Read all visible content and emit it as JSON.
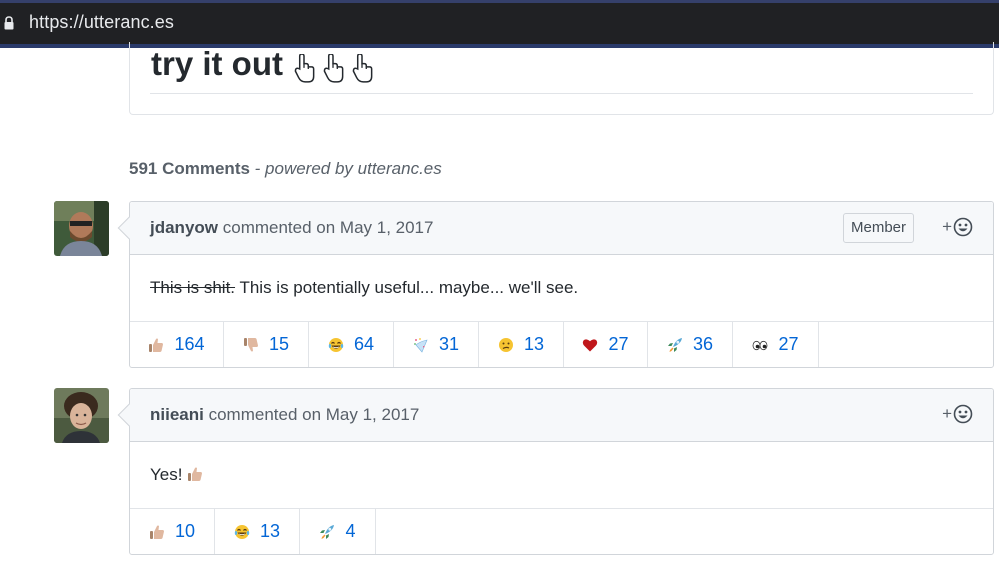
{
  "browser": {
    "url": "https://utteranc.es"
  },
  "hero": {
    "title": "try it out"
  },
  "comments_header": {
    "count_label": "591 Comments",
    "powered_by": " - powered by utteranc.es"
  },
  "comments": [
    {
      "author": "jdanyow",
      "commented_on": " commented on May 1, 2017",
      "badge": "Member",
      "body_struck": "This is shit.",
      "body_text": " This is potentially useful... maybe... we'll see.",
      "reactions": [
        {
          "emoji": "thumbs-up",
          "count": "164"
        },
        {
          "emoji": "thumbs-down",
          "count": "15"
        },
        {
          "emoji": "laugh",
          "count": "64"
        },
        {
          "emoji": "hooray",
          "count": "31"
        },
        {
          "emoji": "confused",
          "count": "13"
        },
        {
          "emoji": "heart",
          "count": "27"
        },
        {
          "emoji": "rocket",
          "count": "36"
        },
        {
          "emoji": "eyes",
          "count": "27"
        }
      ]
    },
    {
      "author": "niieani",
      "commented_on": " commented on May 1, 2017",
      "body_text": "Yes! ",
      "reactions": [
        {
          "emoji": "thumbs-up",
          "count": "10"
        },
        {
          "emoji": "laugh",
          "count": "13"
        },
        {
          "emoji": "rocket",
          "count": "4"
        }
      ]
    }
  ],
  "add_reaction_label": "+",
  "colors": {
    "link": "#0366d6",
    "header_bg": "#f6f8fa",
    "border": "#d1d5da",
    "addressbar_bg": "#202124"
  }
}
